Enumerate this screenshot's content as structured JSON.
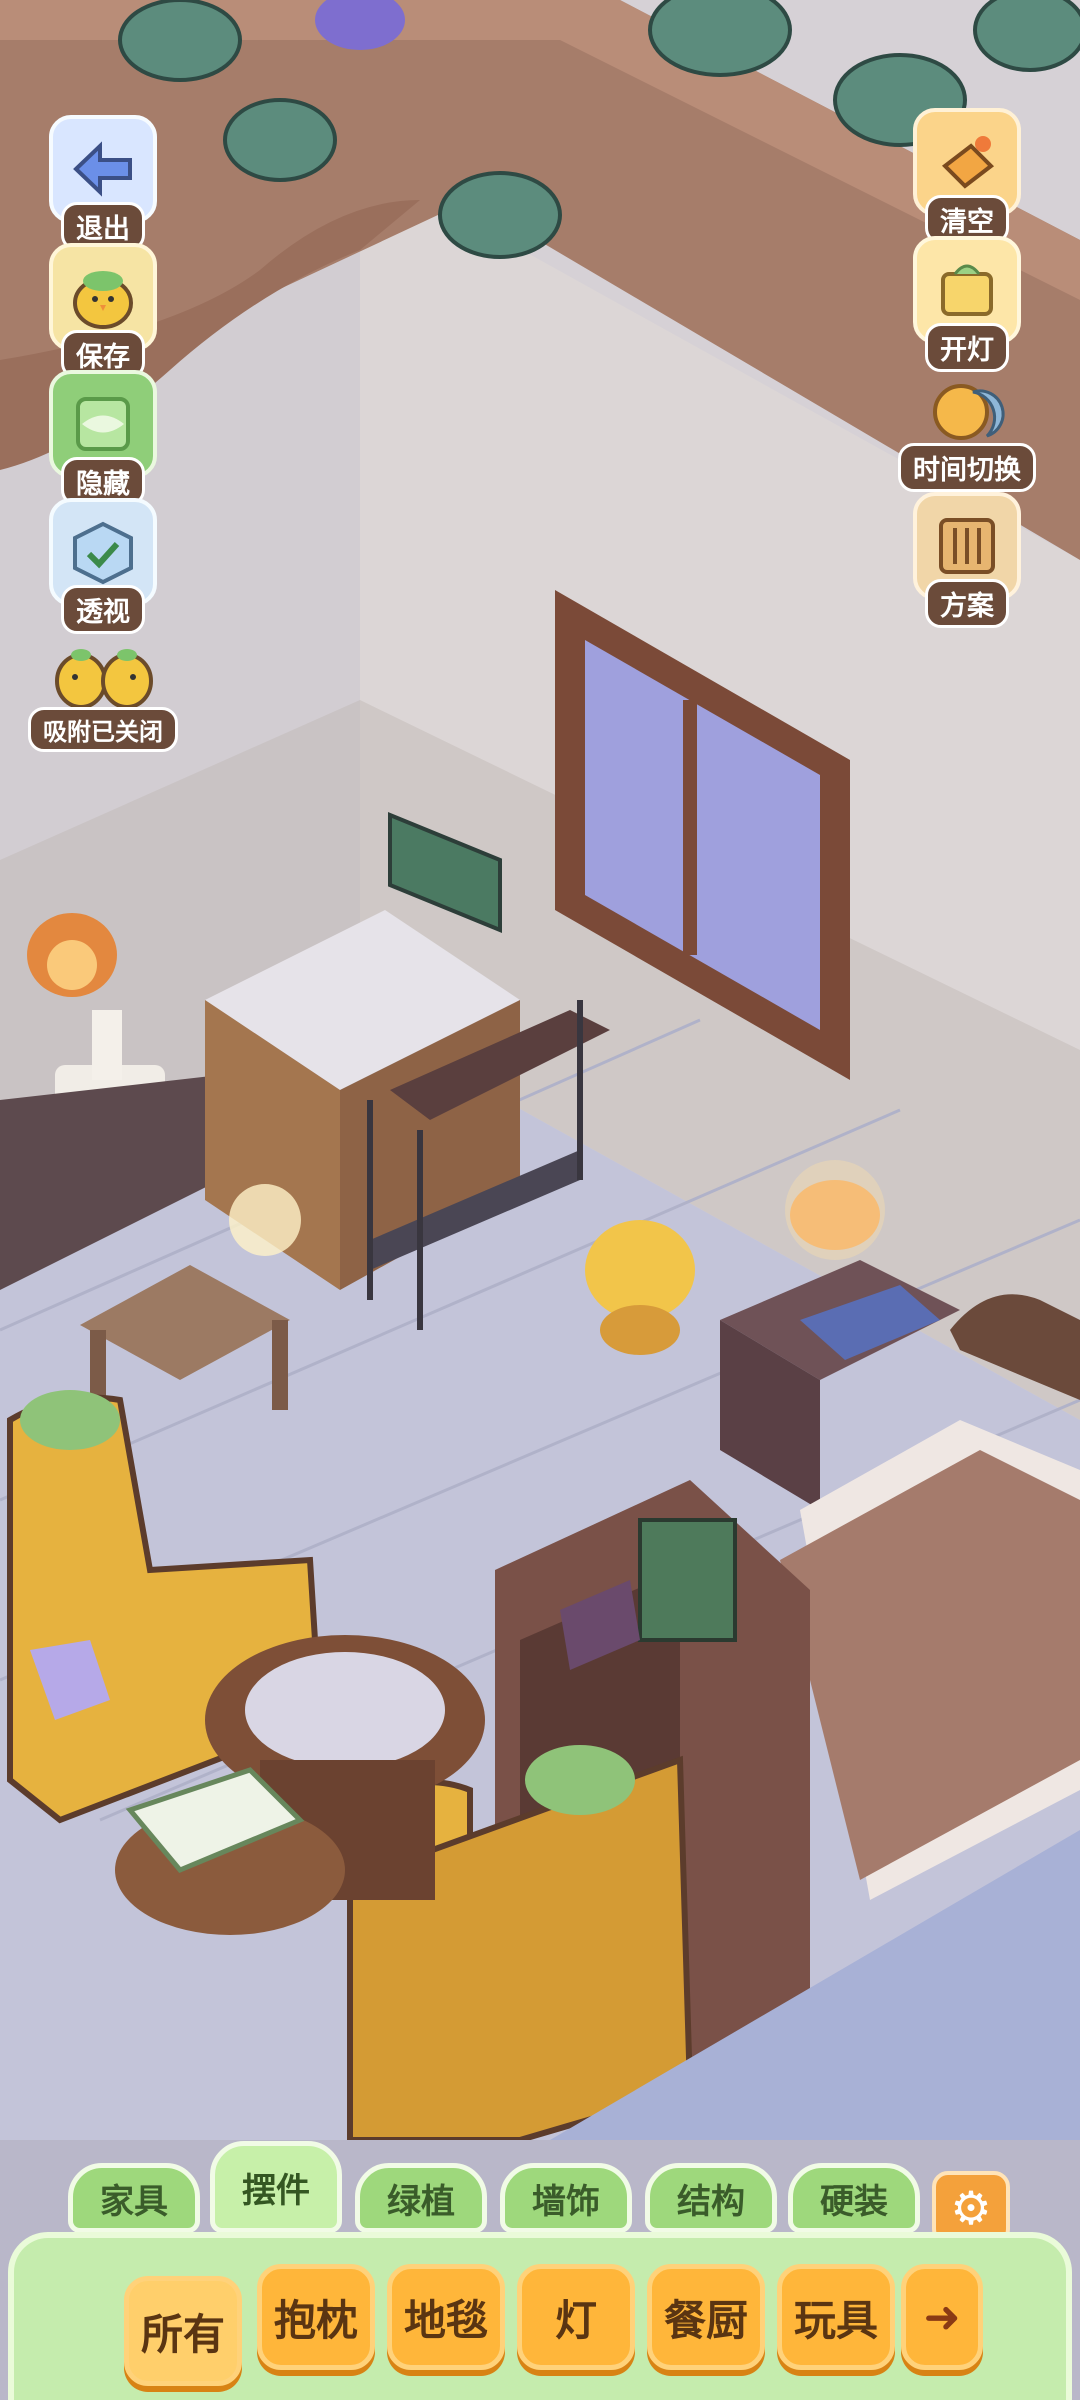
{
  "left_tools": [
    {
      "label": "退出",
      "icon": "exit-arrow-icon"
    },
    {
      "label": "保存",
      "icon": "save-chick-icon"
    },
    {
      "label": "隐藏",
      "icon": "hide-icon"
    },
    {
      "label": "透视",
      "icon": "perspective-cube-icon"
    },
    {
      "label": "吸附已关闭",
      "icon": "snap-chicks-icon"
    }
  ],
  "right_tools": [
    {
      "label": "清空",
      "icon": "clear-icon"
    },
    {
      "label": "开灯",
      "icon": "light-icon"
    },
    {
      "label": "时间切换",
      "icon": "sun-moon-icon"
    },
    {
      "label": "方案",
      "icon": "plan-icon"
    }
  ],
  "category_tabs": [
    "家具",
    "摆件",
    "绿植",
    "墙饰",
    "结构",
    "硬装"
  ],
  "active_tab": "摆件",
  "subcategories": [
    "所有",
    "抱枕",
    "地毯",
    "灯",
    "餐厨",
    "玩具"
  ],
  "active_subcategory": "所有",
  "colors": {
    "tab_green": "#9ed87c",
    "panel_green": "#c5ecad",
    "chip_orange": "#ffb63a",
    "label_brown": "#6b4b3a"
  }
}
